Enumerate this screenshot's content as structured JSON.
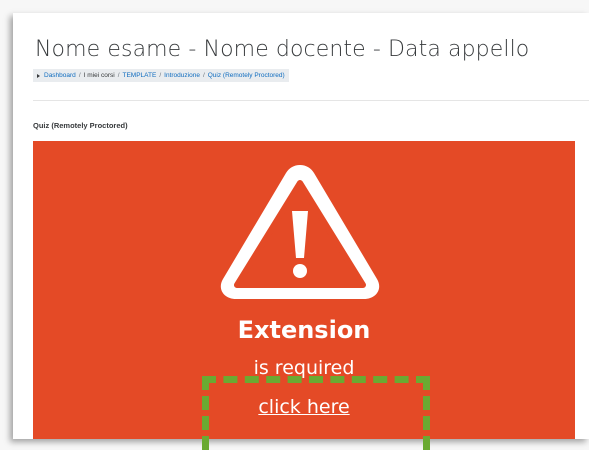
{
  "page": {
    "title": "Nome esame - Nome docente - Data appello"
  },
  "breadcrumb": {
    "items": [
      {
        "label": "Dashboard",
        "link": true
      },
      {
        "label": "I miei corsi",
        "link": false
      },
      {
        "label": "TEMPLATE",
        "link": true
      },
      {
        "label": "Introduzione",
        "link": true
      },
      {
        "label": "Quiz (Remotely Proctored)",
        "link": true
      }
    ],
    "separator": "/"
  },
  "activity": {
    "label": "Quiz (Remotely Proctored)"
  },
  "banner": {
    "background": "#e44a26",
    "icon": "warning-triangle-icon",
    "heading": "Extension",
    "subheading": "is required",
    "link_label": "click here"
  },
  "annotation": {
    "color": "#6aaa32",
    "style": "dashed"
  }
}
